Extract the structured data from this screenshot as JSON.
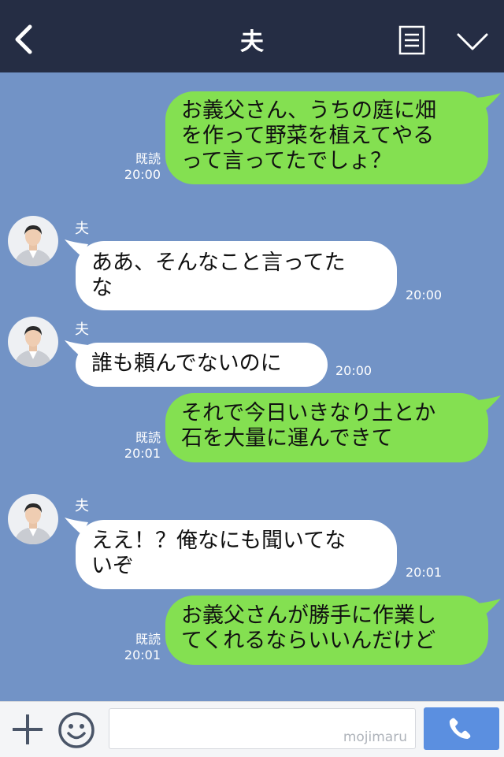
{
  "header": {
    "title": "夫",
    "back_icon": "chevron-left-icon",
    "menu_icon": "menu-icon",
    "collapse_icon": "chevron-down-icon"
  },
  "messages": [
    {
      "side": "out",
      "lines": [
        "お義父さん、うちの庭に畑",
        "を作って野菜を植えてやる",
        "って言ってたでしょ？"
      ],
      "read": "既読",
      "time": "20:00"
    },
    {
      "side": "in",
      "sender": "夫",
      "lines": [
        "ああ、そんなこと言ってた",
        "な"
      ],
      "time": "20:00"
    },
    {
      "side": "in",
      "sender": "夫",
      "lines": [
        "誰も頼んでないのに"
      ],
      "time": "20:00"
    },
    {
      "side": "out",
      "lines": [
        "それで今日いきなり土とか",
        "石を大量に運んできて"
      ],
      "read": "既読",
      "time": "20:01"
    },
    {
      "side": "in",
      "sender": "夫",
      "lines": [
        "ええ！？俺なにも聞いてな",
        "いぞ"
      ],
      "time": "20:01"
    },
    {
      "side": "out",
      "lines": [
        "お義父さんが勝手に作業し",
        "てくれるならいいんだけど"
      ],
      "read": "既読",
      "time": "20:01"
    }
  ],
  "footer": {
    "watermark": "mojimaru",
    "plus_icon": "plus-icon",
    "emoji_icon": "smiley-icon",
    "call_icon": "phone-icon"
  },
  "colors": {
    "header": "#252d44",
    "background": "#7293c6",
    "outgoing_bubble": "#84e051",
    "incoming_bubble": "#ffffff",
    "call_button": "#5b8fe0"
  }
}
